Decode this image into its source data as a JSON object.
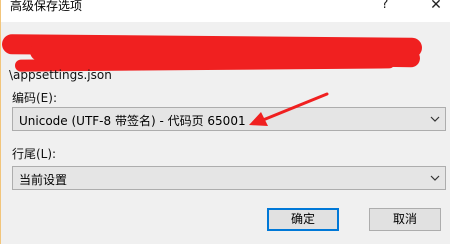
{
  "dialog": {
    "title": "高级保存选项",
    "help_glyph": "?",
    "close_glyph": "✕"
  },
  "path": {
    "visible_tail": "\\appsettings.json"
  },
  "encoding": {
    "label": "编码(E):",
    "value": "Unicode (UTF-8 带签名) - 代码页 65001"
  },
  "line_ending": {
    "label": "行尾(L):",
    "value": "当前设置"
  },
  "buttons": {
    "ok": "确定",
    "cancel": "取消"
  },
  "colors": {
    "redaction": "#f02020",
    "accent_border": "#0078d7"
  }
}
